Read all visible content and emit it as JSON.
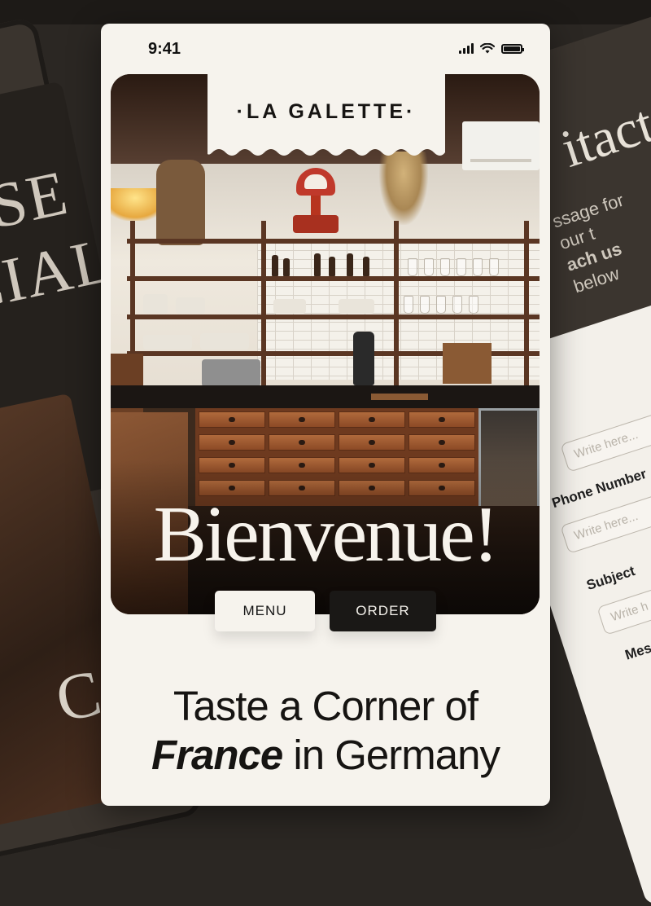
{
  "background": {
    "left_text_lines": [
      "USE",
      "CIAL"
    ],
    "left_bottom_text": "C",
    "right_title": "itact",
    "right_sub_line1": "ssage for our t",
    "right_sub_line2_bold": "ach us",
    "right_sub_line2_rest": " below",
    "form": {
      "field1_placeholder": "Write here...",
      "phone_label": "Phone Number",
      "phone_placeholder": "Write here...",
      "subject_label": "Subject",
      "subject_placeholder": "Write h",
      "message_label": "Mes"
    }
  },
  "status_bar": {
    "time": "9:41"
  },
  "brand": {
    "logo": "·LA GALETTE·"
  },
  "hero": {
    "headline": "Bienvenue!"
  },
  "buttons": {
    "menu": "MENU",
    "order": "ORDER"
  },
  "tagline": {
    "line1": "Taste a Corner of",
    "line2_emph": "France",
    "line2_rest": " in Germany"
  },
  "colors": {
    "page_bg": "#f6f3ed",
    "dark_button": "#1a1816",
    "text": "#161412"
  },
  "icons": [
    "signal-icon",
    "wifi-icon",
    "battery-icon"
  ]
}
